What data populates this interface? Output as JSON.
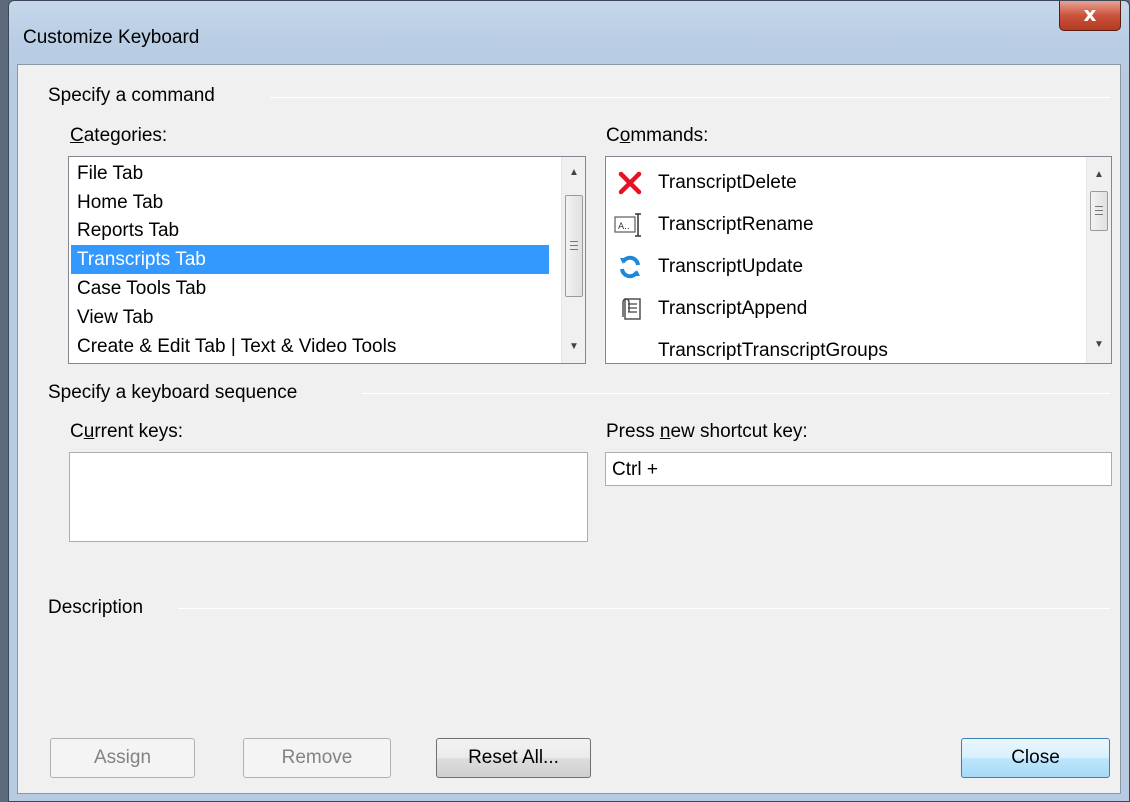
{
  "window": {
    "title": "Customize Keyboard",
    "close_glyph": "x"
  },
  "command_group": {
    "title": "Specify a command",
    "categories_label": {
      "pre": "",
      "key": "C",
      "post": "ategories:"
    },
    "commands_label": {
      "pre": "C",
      "key": "o",
      "post": "mmands:"
    },
    "categories": [
      "File Tab",
      "Home Tab",
      "Reports Tab",
      "Transcripts Tab",
      "Case Tools Tab",
      "View Tab",
      "Create & Edit Tab | Text & Video Tools"
    ],
    "selected_category_index": 3,
    "commands": [
      {
        "label": "TranscriptDelete",
        "icon": "delete-x-icon"
      },
      {
        "label": "TranscriptRename",
        "icon": "rename-icon"
      },
      {
        "label": "TranscriptUpdate",
        "icon": "refresh-icon"
      },
      {
        "label": "TranscriptAppend",
        "icon": "append-icon"
      },
      {
        "label": "TranscriptTranscriptGroups",
        "icon": ""
      }
    ]
  },
  "keyboard_group": {
    "title": "Specify a keyboard sequence",
    "current_keys_label": {
      "pre": "C",
      "key": "u",
      "post": "rrent keys:"
    },
    "new_shortcut_label": {
      "pre": "Press ",
      "key": "n",
      "post": "ew shortcut key:"
    },
    "new_shortcut_value": "Ctrl +"
  },
  "description_group": {
    "title": "Description"
  },
  "buttons": {
    "assign": "Assign",
    "remove": "Remove",
    "reset_all": "Reset All...",
    "close": "Close"
  },
  "colors": {
    "selection": "#3399ff",
    "delete_icon": "#e81123",
    "refresh_icon": "#1e88d8"
  }
}
